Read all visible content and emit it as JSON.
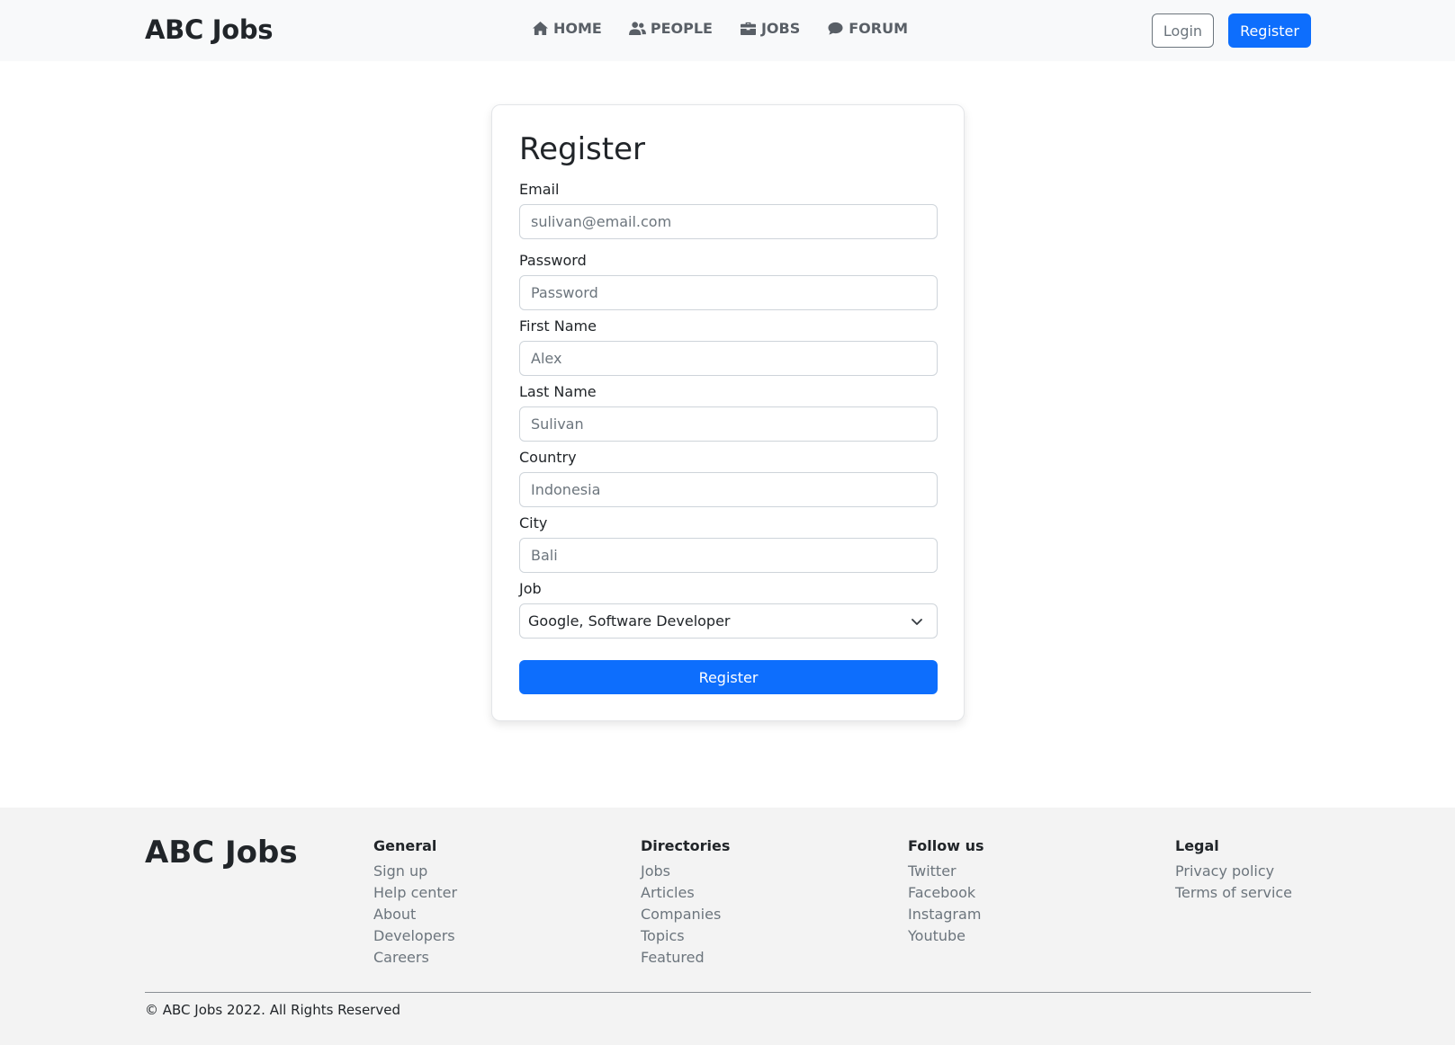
{
  "header": {
    "brand": "ABC Jobs",
    "nav": [
      {
        "label": "HOME",
        "icon": "home-icon"
      },
      {
        "label": "PEOPLE",
        "icon": "people-icon"
      },
      {
        "label": "JOBS",
        "icon": "briefcase-icon"
      },
      {
        "label": "FORUM",
        "icon": "chat-icon"
      }
    ],
    "login_label": "Login",
    "register_label": "Register"
  },
  "form": {
    "title": "Register",
    "fields": [
      {
        "label": "Email",
        "placeholder": "sulivan@email.com"
      },
      {
        "label": "Password",
        "placeholder": "Password"
      },
      {
        "label": "First Name",
        "placeholder": "Alex"
      },
      {
        "label": "Last Name",
        "placeholder": "Sulivan"
      },
      {
        "label": "Country",
        "placeholder": "Indonesia"
      },
      {
        "label": "City",
        "placeholder": "Bali"
      }
    ],
    "job": {
      "label": "Job",
      "selected": "Google, Software Developer"
    },
    "submit_label": "Register"
  },
  "footer": {
    "brand": "ABC Jobs",
    "columns": [
      {
        "title": "General",
        "links": [
          "Sign up",
          "Help center",
          "About",
          "Developers",
          "Careers"
        ]
      },
      {
        "title": "Directories",
        "links": [
          "Jobs",
          "Articles",
          "Companies",
          "Topics",
          "Featured"
        ]
      },
      {
        "title": "Follow us",
        "links": [
          "Twitter",
          "Facebook",
          "Instagram",
          "Youtube"
        ]
      },
      {
        "title": "Legal",
        "links": [
          "Privacy policy",
          "Terms of service"
        ]
      }
    ],
    "copyright": "© ABC Jobs 2022. All Rights Reserved"
  },
  "colors": {
    "primary": "#0d6efd",
    "navbar_bg": "#f8f9fa",
    "footer_bg": "#f3f3f3",
    "muted_text": "#6c757d"
  }
}
